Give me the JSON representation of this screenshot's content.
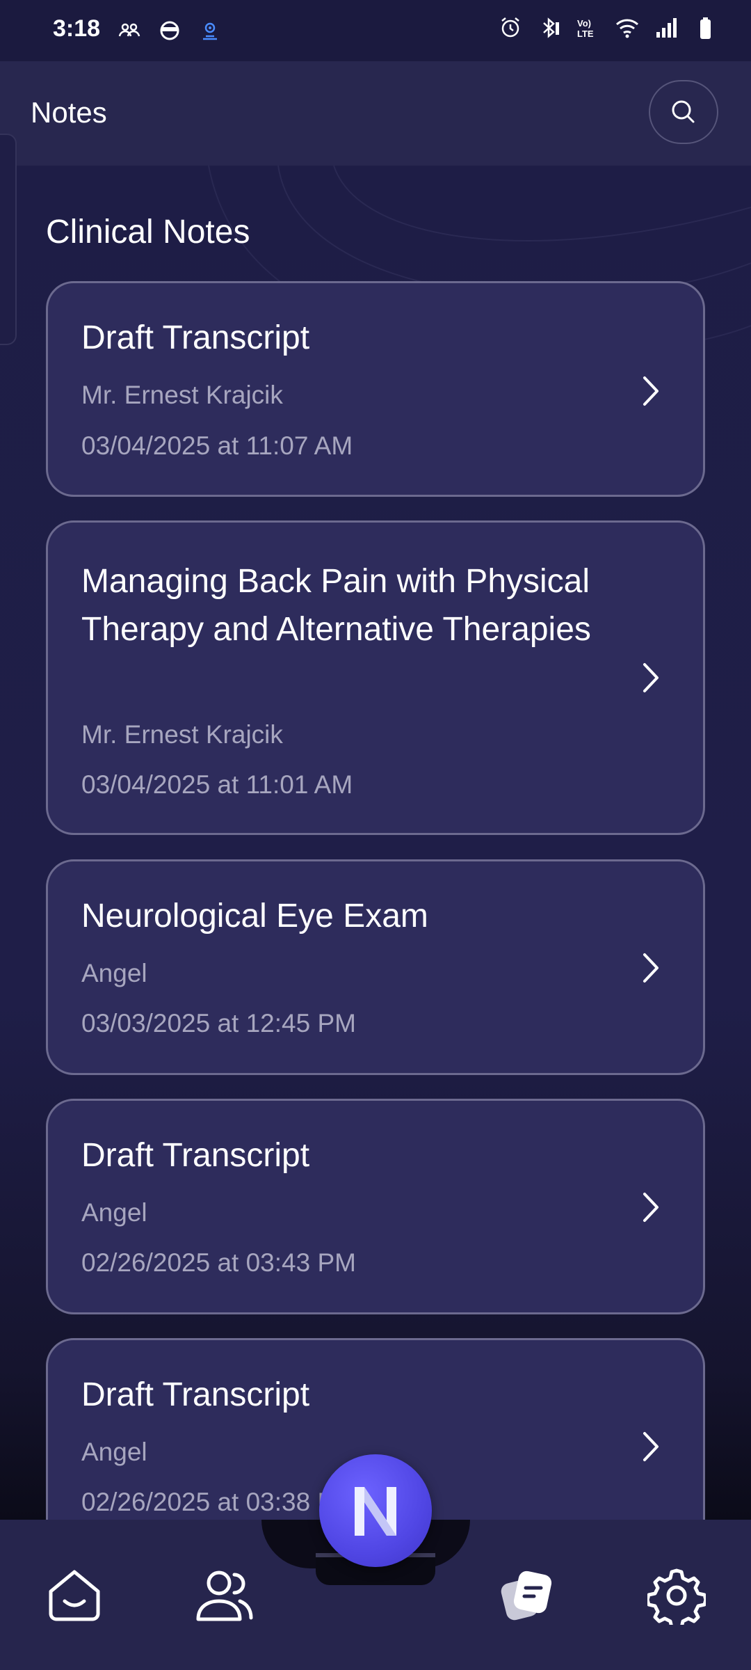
{
  "status_bar": {
    "time": "3:18",
    "left_icons": [
      "people-icon",
      "face-icon",
      "hotspot-icon"
    ],
    "right_icons": [
      "alarm-icon",
      "bluetooth-icon",
      "volte-icon",
      "wifi-icon",
      "signal-icon",
      "battery-icon"
    ]
  },
  "app_bar": {
    "title": "Notes",
    "search_icon": "search-icon"
  },
  "section": {
    "title": "Clinical Notes"
  },
  "notes": [
    {
      "title": "Draft Transcript",
      "patient": "Mr. Ernest Krajcik",
      "date": "03/04/2025 at 11:07 AM"
    },
    {
      "title": "Managing Back Pain with Physical Therapy and Alternative Therapies",
      "patient": "Mr. Ernest Krajcik",
      "date": "03/04/2025 at 11:01 AM"
    },
    {
      "title": "Neurological Eye Exam",
      "patient": "Angel",
      "date": "03/03/2025 at 12:45 PM"
    },
    {
      "title": "Draft Transcript",
      "patient": "Angel",
      "date": "02/26/2025 at 03:43 PM"
    },
    {
      "title": "Draft Transcript",
      "patient": "Angel",
      "date": "02/26/2025 at 03:38 PM"
    }
  ],
  "bottom_nav": {
    "items": [
      "home-icon",
      "patients-icon",
      "notes-icon",
      "settings-icon"
    ],
    "fab_icon": "brand-logo-icon",
    "active": "notes-icon",
    "accent": "#5b52f0"
  }
}
